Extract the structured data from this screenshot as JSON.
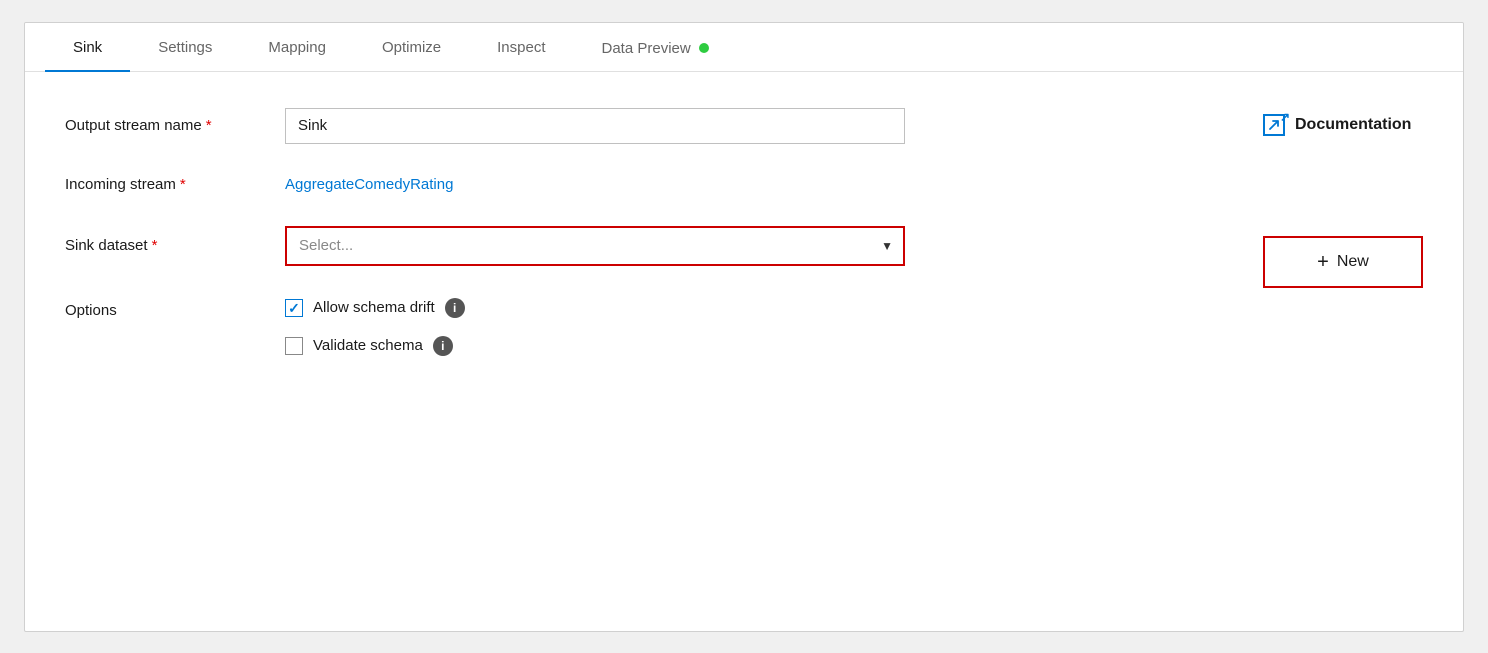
{
  "tabs": [
    {
      "id": "sink",
      "label": "Sink",
      "active": true
    },
    {
      "id": "settings",
      "label": "Settings",
      "active": false
    },
    {
      "id": "mapping",
      "label": "Mapping",
      "active": false
    },
    {
      "id": "optimize",
      "label": "Optimize",
      "active": false
    },
    {
      "id": "inspect",
      "label": "Inspect",
      "active": false
    },
    {
      "id": "data-preview",
      "label": "Data Preview",
      "active": false
    }
  ],
  "form": {
    "output_stream_name_label": "Output stream name",
    "output_stream_name_value": "Sink",
    "output_stream_name_placeholder": "Sink",
    "incoming_stream_label": "Incoming stream",
    "incoming_stream_value": "AggregateComedyRating",
    "sink_dataset_label": "Sink dataset",
    "sink_dataset_placeholder": "Select...",
    "options_label": "Options",
    "allow_schema_drift_label": "Allow schema drift",
    "allow_schema_drift_checked": true,
    "validate_schema_label": "Validate schema",
    "validate_schema_checked": false
  },
  "sidebar": {
    "documentation_label": "Documentation",
    "new_button_label": "New",
    "plus_symbol": "+"
  },
  "required_marker": "*",
  "data_preview_dot_color": "#2ecc40"
}
